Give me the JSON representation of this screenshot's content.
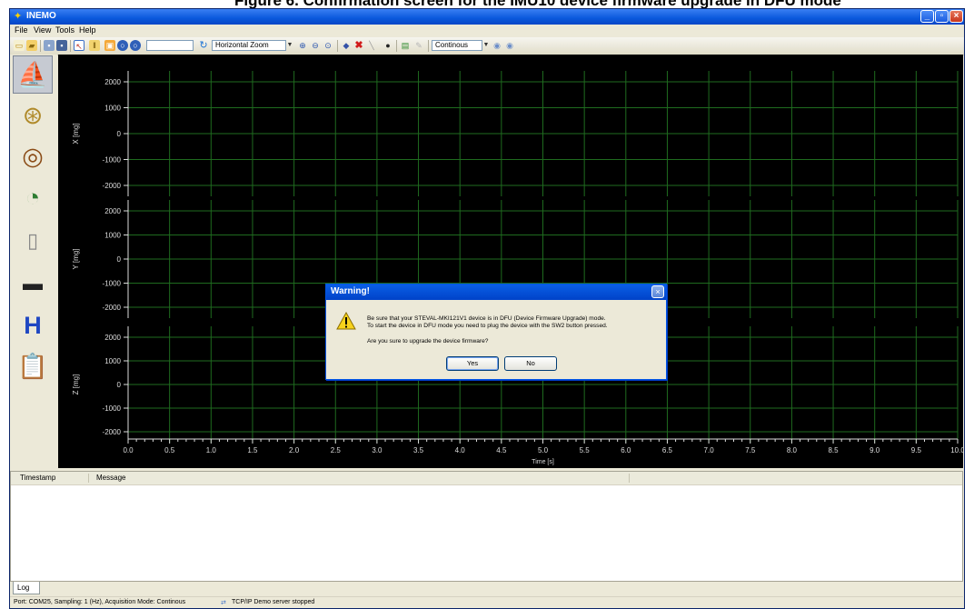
{
  "caption": "Figure 6. Confirmation screen for the IMU10 device firmware upgrade in DFU mode",
  "window": {
    "title": "INEMO",
    "minimize_icon": "minimize-icon",
    "maximize_icon": "maximize-icon",
    "close_icon": "close-icon"
  },
  "menu": [
    "File",
    "View",
    "Tools",
    "Help"
  ],
  "toolbar": {
    "samples_value": "",
    "zoom_mode": "Horizontal Zoom",
    "acquisition_mode": "Continous",
    "icons": [
      "new-icon",
      "open-icon",
      "save-icon",
      "save-as-icon",
      "cursor-icon",
      "pause-icon",
      "settings-icon",
      "connect-icon",
      "disconnect-icon",
      "refresh-icon",
      "zoom-in-icon",
      "zoom-out-icon",
      "zoom-fit-icon",
      "marker-icon",
      "delete-icon",
      "line-icon",
      "record-icon",
      "export-icon",
      "pencil-icon",
      "play-icon",
      "stop-icon"
    ]
  },
  "sidebar": {
    "items": [
      {
        "icon": "sailboat-icon",
        "active": true
      },
      {
        "icon": "gyroscope-icon",
        "active": false
      },
      {
        "icon": "compass-icon",
        "active": false
      },
      {
        "icon": "gauge-icon",
        "active": false
      },
      {
        "icon": "thermometer-icon",
        "active": false
      },
      {
        "icon": "device-icon",
        "active": false
      },
      {
        "icon": "sensor-fusion-icon",
        "active": false
      },
      {
        "icon": "clipboard-icon",
        "active": false
      }
    ]
  },
  "chart_data": {
    "type": "line",
    "xlabel": "Time [s]",
    "xlim": [
      0,
      10
    ],
    "xticks": [
      "0.0",
      "0.5",
      "1.0",
      "1.5",
      "2.0",
      "2.5",
      "3.0",
      "3.5",
      "4.0",
      "4.5",
      "5.0",
      "5.5",
      "6.0",
      "6.5",
      "7.0",
      "7.5",
      "8.0",
      "8.5",
      "9.0",
      "9.5",
      "10.0"
    ],
    "grid": true,
    "panels": [
      {
        "ylabel": "X [mg]",
        "ylim": [
          -2000,
          2000
        ],
        "yticks": [
          "2000",
          "1000",
          "0",
          "-1000",
          "-2000"
        ],
        "series": []
      },
      {
        "ylabel": "Y [mg]",
        "ylim": [
          -2000,
          2000
        ],
        "yticks": [
          "2000",
          "1000",
          "0",
          "-1000",
          "-2000"
        ],
        "series": []
      },
      {
        "ylabel": "Z [mg]",
        "ylim": [
          -2000,
          2000
        ],
        "yticks": [
          "2000",
          "1000",
          "0",
          "-1000",
          "-2000"
        ],
        "series": []
      }
    ]
  },
  "dialog": {
    "title": "Warning!",
    "line1": "Be sure that your STEVAL-MKI121V1 device is in DFU (Device Firmware Upgrade) mode.",
    "line2": "To start the device in DFU mode you need to plug the device with the SW2 button pressed.",
    "question": "Are you sure to upgrade the device firmware?",
    "yes_label": "Yes",
    "no_label": "No"
  },
  "log": {
    "columns": [
      "Timestamp",
      "Message"
    ],
    "rows": [],
    "tab_label": "Log"
  },
  "status": {
    "text": "Port: COM25, Sampling: 1 (Hz), Acquisition Mode: Continous",
    "tcp_text": "TCP/IP Demo server stopped"
  }
}
